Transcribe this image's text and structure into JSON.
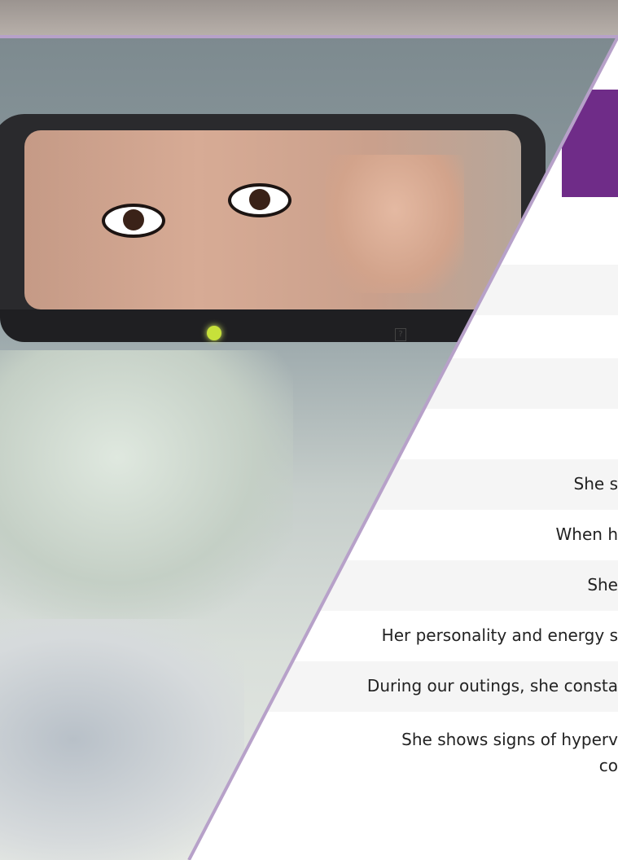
{
  "rows": [
    {
      "text": "She s",
      "shade": true
    },
    {
      "text": "When h",
      "shade": false
    },
    {
      "text": "She",
      "shade": true
    },
    {
      "text": "Her personality and energy s",
      "shade": false
    },
    {
      "text": "During our outings, she consta",
      "shade": true
    },
    {
      "text": "She shows signs of hyperv",
      "text2": "co",
      "shade": false
    }
  ],
  "glyph": "?",
  "colors": {
    "accent": "#6f2c88",
    "line": "#b7a1c9"
  }
}
